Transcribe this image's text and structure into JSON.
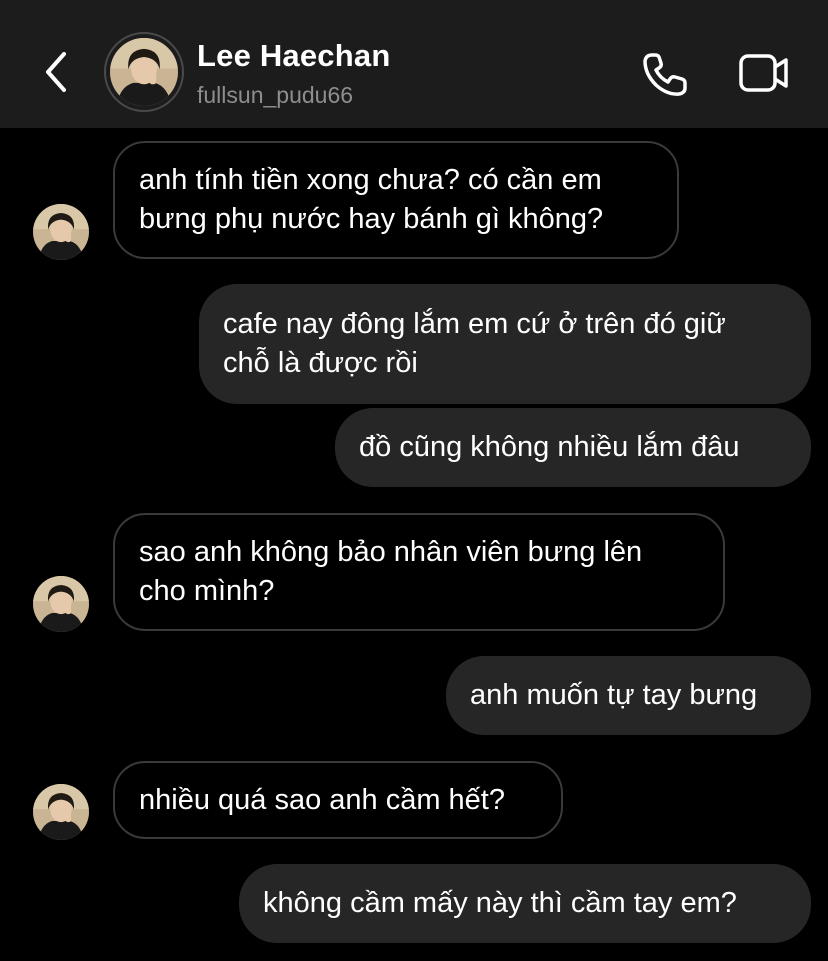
{
  "header": {
    "name": "Lee Haechan",
    "username": "fullsun_pudu66",
    "icons": {
      "back": "chevron-left-icon",
      "call": "phone-icon",
      "video": "video-camera-icon"
    }
  },
  "messages": [
    {
      "sender": "them",
      "text": "anh tính tiền xong chưa? có cần em\nbưng phụ nước hay bánh gì không?"
    },
    {
      "sender": "me",
      "text": "cafe nay đông lắm em cứ ở trên đó giữ\nchỗ là được rồi"
    },
    {
      "sender": "me",
      "text": "đồ cũng không nhiều lắm đâu"
    },
    {
      "sender": "them",
      "text": "sao anh không bảo nhân viên bưng lên\ncho mình?"
    },
    {
      "sender": "me",
      "text": "anh muốn tự tay bưng"
    },
    {
      "sender": "them",
      "text": "nhiều quá sao anh cầm hết?"
    },
    {
      "sender": "me",
      "text": "không cầm mấy này thì cầm tay em?"
    }
  ],
  "colors": {
    "background": "#000000",
    "header": "#1c1c1c",
    "outgoing_bubble": "#262626",
    "incoming_border": "#3a3a3a",
    "secondary_text": "#8e8e8e"
  }
}
